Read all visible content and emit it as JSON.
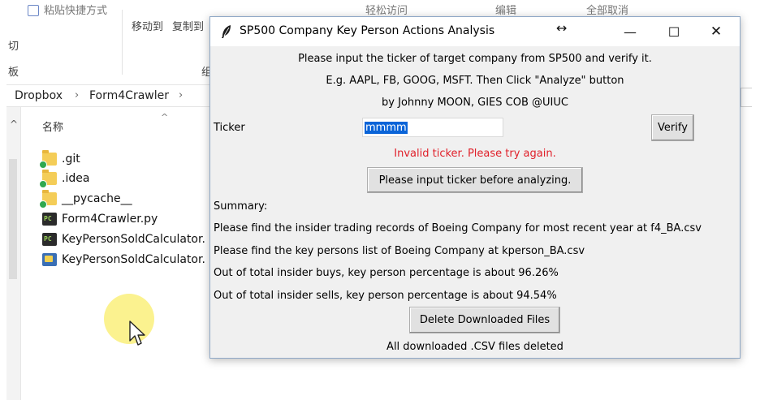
{
  "explorer": {
    "ribbon": {
      "paste_shortcut": "粘贴快捷方式",
      "move_to": "移动到",
      "copy_to": "复制到",
      "easy_access": "轻松访问",
      "edit": "编辑",
      "select_none": "全部取消",
      "cut_label": "切",
      "left_char2": "板",
      "group_char": "组"
    },
    "breadcrumb": [
      "Dropbox",
      "Form4Crawler"
    ],
    "column_header": "名称",
    "files": [
      {
        "name": ".git",
        "icon": "folder-synced-icon"
      },
      {
        "name": ".idea",
        "icon": "folder-synced-icon"
      },
      {
        "name": "__pycache__",
        "icon": "folder-synced-icon"
      },
      {
        "name": "Form4Crawler.py",
        "icon": "pycharm-file-icon"
      },
      {
        "name": "KeyPersonSoldCalculator.",
        "icon": "pycharm-file-icon"
      },
      {
        "name": "KeyPersonSoldCalculator.",
        "icon": "python-window-file-icon"
      }
    ]
  },
  "dialog": {
    "title": "SP500 Company Key Person Actions Analysis",
    "resize_indicator": "↔",
    "controls": {
      "minimize": "—",
      "maximize": "☐",
      "close": "✕"
    },
    "intro_lines": [
      "Please input the ticker of target company from SP500 and verify it.",
      "E.g. AAPL, FB, GOOG, MSFT. Then Click \"Analyze\" button",
      "by Johnny MOON, GIES COB @UIUC"
    ],
    "ticker_label": "Ticker",
    "ticker_value": "mmmm",
    "verify_button": "Verify",
    "error_message": "Invalid ticker. Please try again.",
    "error_color": "#e0202a",
    "analyze_button": "Please input ticker before analyzing.",
    "summary_title": "Summary:",
    "summary_lines": [
      "Please find the insider trading records of Boeing Company for most recent year at f4_BA.csv",
      "Please find the key persons list of Boeing Company at kperson_BA.csv",
      "Out of total insider buys, key person percentage is about 96.26%",
      "Out of total insider sells, key person percentage is about 94.54%"
    ],
    "delete_button": "Delete Downloaded Files",
    "delete_status": "All downloaded .CSV files deleted"
  }
}
